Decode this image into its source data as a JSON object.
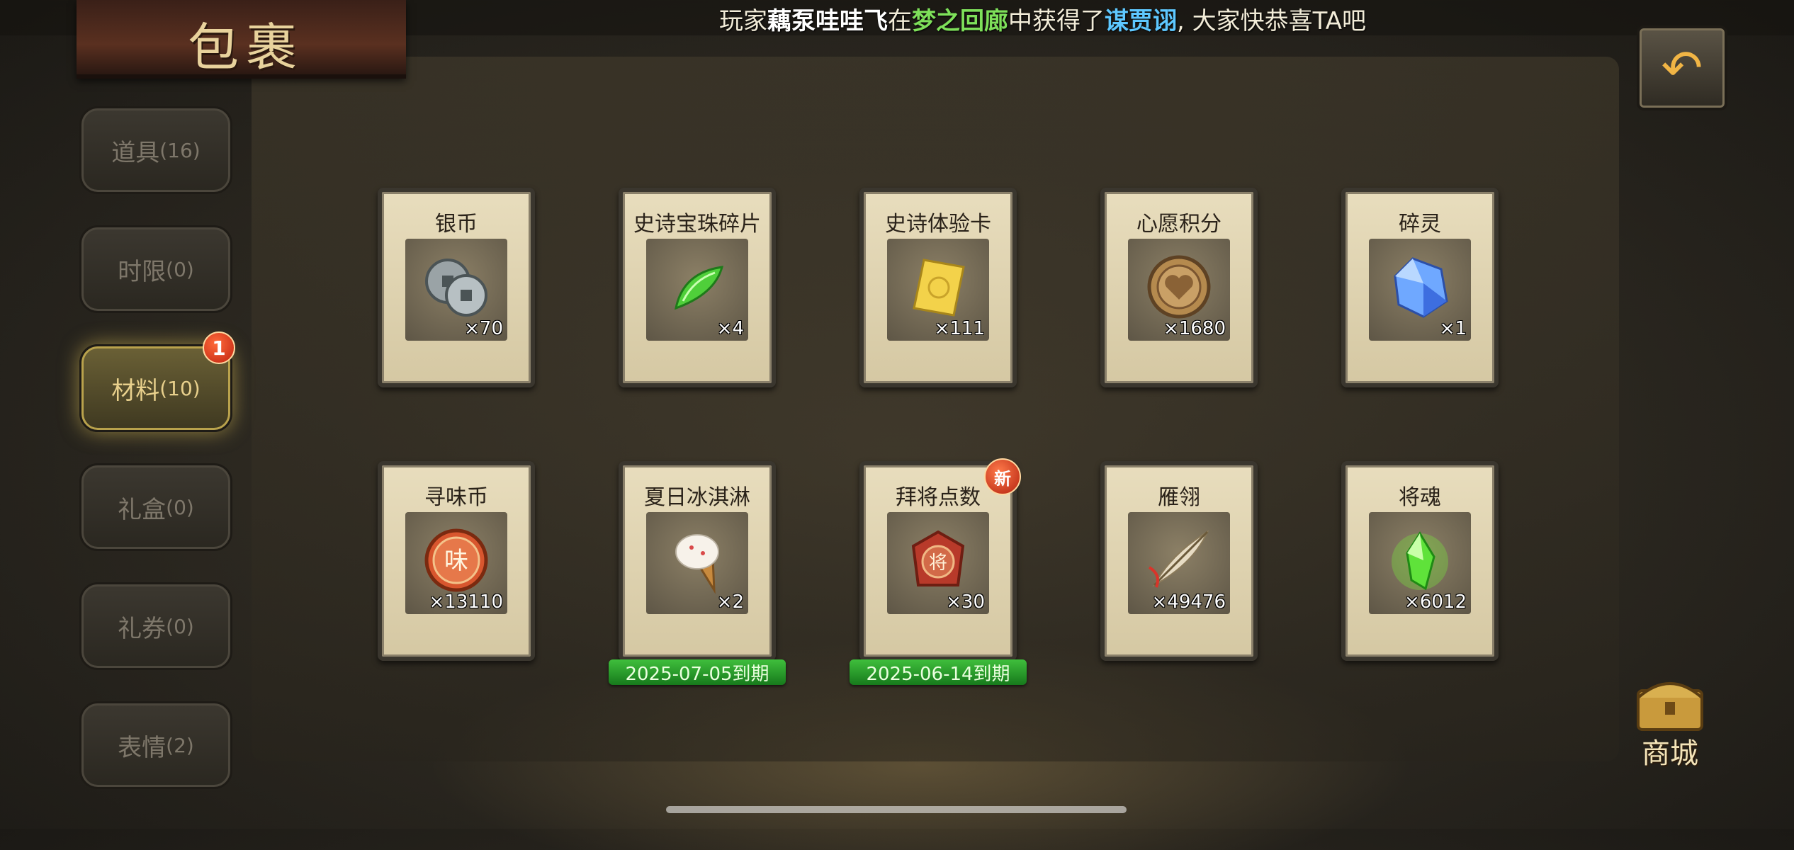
{
  "header": {
    "title": "包裹",
    "ticker": {
      "prefix": "玩家",
      "player": "藕泵哇哇飞",
      "mid1": "在",
      "place": "梦之回廊",
      "mid2": "中获得了",
      "item": "谋贾诩",
      "suffix": ", 大家快恭喜TA吧"
    }
  },
  "back_button": {
    "icon": "back-arrow-icon"
  },
  "tabs": [
    {
      "label": "道具",
      "count": "(16)",
      "active": false
    },
    {
      "label": "时限",
      "count": "(0)",
      "active": false
    },
    {
      "label": "材料",
      "count": "(10)",
      "active": true,
      "badge": "1"
    },
    {
      "label": "礼盒",
      "count": "(0)",
      "active": false
    },
    {
      "label": "礼券",
      "count": "(0)",
      "active": false
    },
    {
      "label": "表情",
      "count": "(2)",
      "active": false
    }
  ],
  "items": [
    {
      "name": "银币",
      "qty": "×70",
      "icon": "silver-coin-icon"
    },
    {
      "name": "史诗宝珠碎片",
      "qty": "×4",
      "icon": "green-jade-shard-icon"
    },
    {
      "name": "史诗体验卡",
      "qty": "×111",
      "icon": "gold-card-icon"
    },
    {
      "name": "心愿积分",
      "qty": "×1680",
      "icon": "heart-coin-icon"
    },
    {
      "name": "碎灵",
      "qty": "×1",
      "icon": "blue-crystal-icon"
    },
    {
      "name": "寻味币",
      "qty": "×13110",
      "icon": "flavor-coin-icon",
      "icon_text": "味"
    },
    {
      "name": "夏日冰淇淋",
      "qty": "×2",
      "icon": "ice-cream-icon",
      "expiry": "2025-07-05到期"
    },
    {
      "name": "拜将点数",
      "qty": "×30",
      "icon": "red-token-icon",
      "icon_text": "将",
      "expiry": "2025-06-14到期",
      "new_label": "新"
    },
    {
      "name": "雁翎",
      "qty": "×49476",
      "icon": "feather-icon"
    },
    {
      "name": "将魂",
      "qty": "×6012",
      "icon": "green-soul-crystal-icon"
    }
  ],
  "shop": {
    "label": "商城",
    "icon": "treasure-chest-icon"
  },
  "colors": {
    "accent_gold": "#e8d08c",
    "ticker_place": "#7ee05a",
    "ticker_item": "#5ec8ff",
    "expiry_green": "#2e9e2e",
    "badge_red": "#d8391c"
  }
}
